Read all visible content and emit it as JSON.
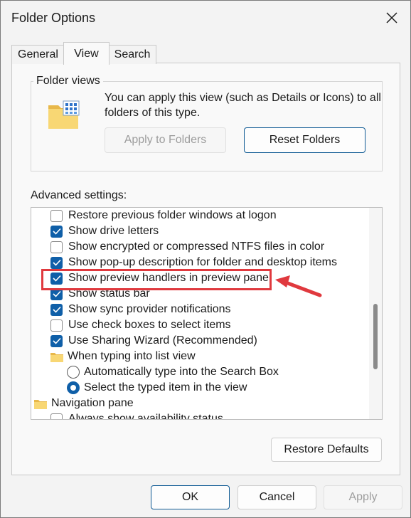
{
  "window": {
    "title": "Folder Options",
    "close_icon": "close-icon"
  },
  "tabs": [
    {
      "label": "General",
      "active": false
    },
    {
      "label": "View",
      "active": true
    },
    {
      "label": "Search",
      "active": false
    }
  ],
  "folder_views": {
    "legend": "Folder views",
    "description": "You can apply this view (such as Details or Icons) to all folders of this type.",
    "apply_button": "Apply to Folders",
    "reset_button": "Reset Folders"
  },
  "advanced": {
    "label": "Advanced settings:",
    "items": [
      {
        "type": "checkbox",
        "checked": false,
        "label": "Restore previous folder windows at logon"
      },
      {
        "type": "checkbox",
        "checked": true,
        "label": "Show drive letters"
      },
      {
        "type": "checkbox",
        "checked": false,
        "label": "Show encrypted or compressed NTFS files in color"
      },
      {
        "type": "checkbox",
        "checked": true,
        "label": "Show pop-up description for folder and desktop items"
      },
      {
        "type": "checkbox",
        "checked": true,
        "label": "Show preview handlers in preview pane"
      },
      {
        "type": "checkbox",
        "checked": true,
        "label": "Show status bar"
      },
      {
        "type": "checkbox",
        "checked": true,
        "label": "Show sync provider notifications"
      },
      {
        "type": "checkbox",
        "checked": false,
        "label": "Use check boxes to select items"
      },
      {
        "type": "checkbox",
        "checked": true,
        "label": "Use Sharing Wizard (Recommended)"
      },
      {
        "type": "folder",
        "label": "When typing into list view"
      },
      {
        "type": "radio",
        "checked": false,
        "label": "Automatically type into the Search Box"
      },
      {
        "type": "radio",
        "checked": true,
        "label": "Select the typed item in the view"
      },
      {
        "type": "folder",
        "label": "Navigation pane"
      },
      {
        "type": "checkbox",
        "checked": false,
        "label": "Always show availability status"
      }
    ]
  },
  "restore_defaults": "Restore Defaults",
  "footer": {
    "ok": "OK",
    "cancel": "Cancel",
    "apply": "Apply"
  },
  "colors": {
    "accent": "#0f5fa8",
    "highlight": "#e0393e"
  }
}
